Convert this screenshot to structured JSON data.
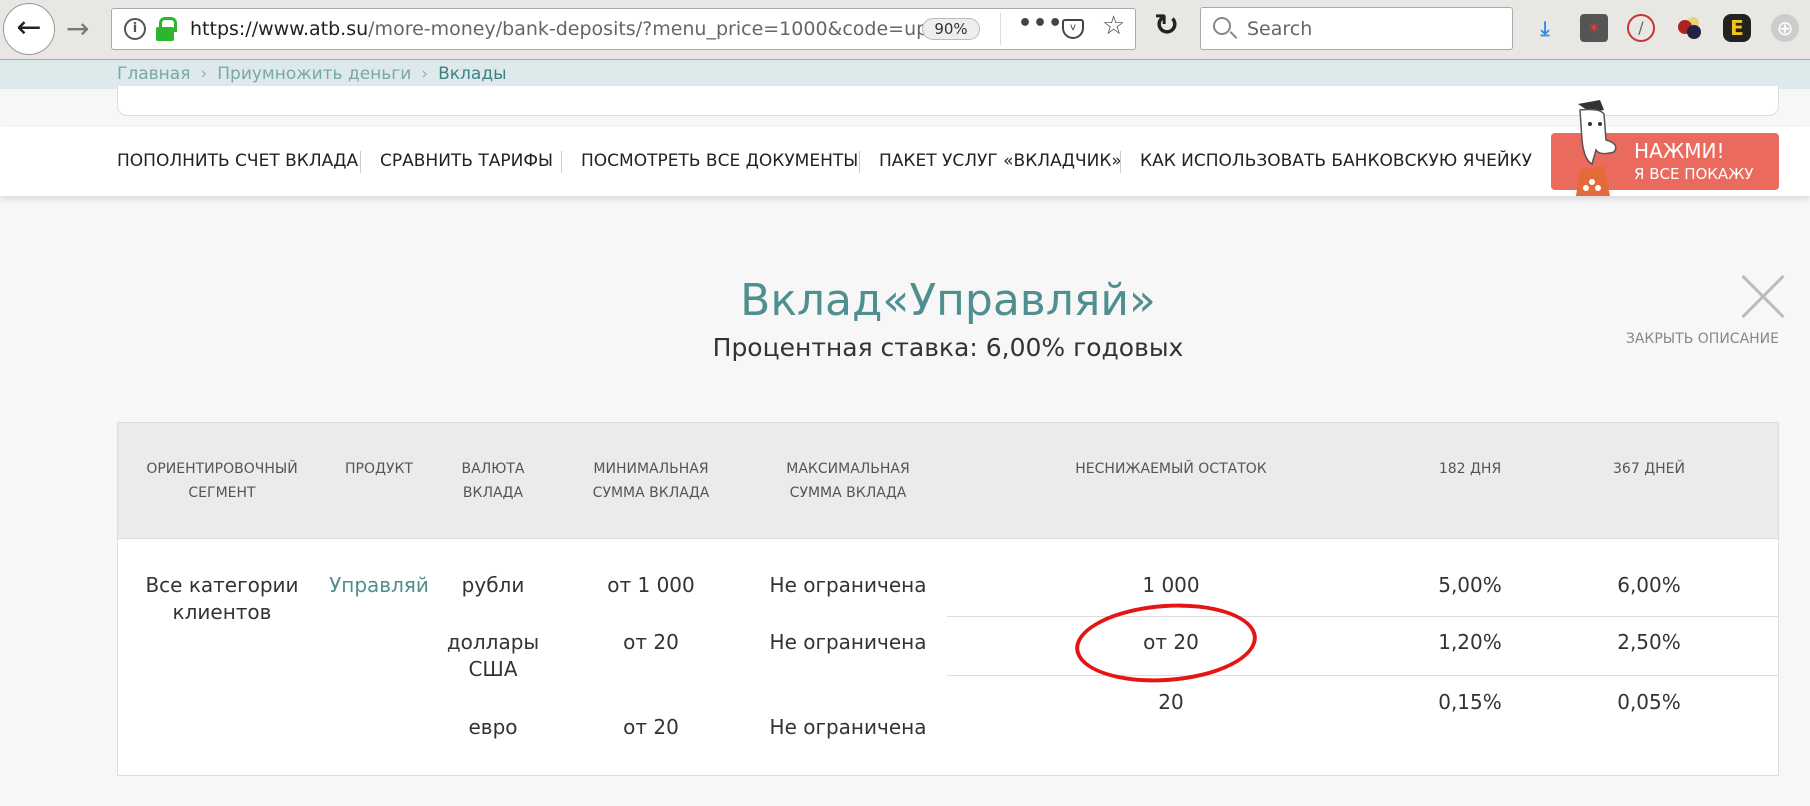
{
  "browser": {
    "url_host": "https://www.atb.su",
    "url_path": "/more-money/bank-deposits/?menu_price=1000&code=up",
    "zoom": "90%",
    "search_placeholder": "Search"
  },
  "breadcrumb": [
    {
      "label": "Главная"
    },
    {
      "label": "Приумножить деньги"
    },
    {
      "label": "Вклады"
    }
  ],
  "nav": {
    "items": [
      "ПОПОЛНИТЬ СЧЕТ ВКЛАДА",
      "СРАВНИТЬ ТАРИФЫ",
      "ПОСМОТРЕТЬ ВСЕ ДОКУМЕНТЫ",
      "ПАКЕТ УСЛУГ «ВКЛАДЧИК»",
      "КАК ИСПОЛЬЗОВАТЬ БАНКОВСКУЮ ЯЧЕЙКУ"
    ],
    "cta_line1": "НАЖМИ!",
    "cta_line2": "Я ВСЕ ПОКАЖУ",
    "cta_color": "#ea6a5d"
  },
  "deposit": {
    "title": "Вклад«Управляй»",
    "rate": "Процентная ставка: 6,00% годовых",
    "close_label": "ЗАКРЫТЬ ОПИСАНИЕ",
    "accent": "#4f8f8f"
  },
  "table": {
    "headers": [
      [
        "ОРИЕНТИРОВОЧНЫЙ",
        "СЕГМЕНТ"
      ],
      [
        "ПРОДУКТ",
        ""
      ],
      [
        "ВАЛЮТА",
        "ВКЛАДА"
      ],
      [
        "МИНИМАЛЬНАЯ",
        "СУММА ВКЛАДА"
      ],
      [
        "МАКСИМАЛЬНАЯ",
        "СУММА ВКЛАДА"
      ],
      [
        "НЕСНИЖАЕМЫЙ ОСТАТОК",
        ""
      ],
      [
        "182 ДНЯ",
        ""
      ],
      [
        "367 ДНЕЙ",
        ""
      ]
    ],
    "segment": [
      "Все категории",
      "клиентов"
    ],
    "product": "Управляй",
    "rows": [
      {
        "currency": [
          "рубли",
          ""
        ],
        "min": "от 1 000",
        "max": "Не ограничена",
        "balance": "1 000",
        "d182": "5,00%",
        "d367": "6,00%"
      },
      {
        "currency": [
          "доллары",
          "США"
        ],
        "min": "от 20",
        "max": "Не ограничена",
        "balance": "от 20",
        "d182": "1,20%",
        "d367": "2,50%"
      },
      {
        "currency": [
          "евро",
          ""
        ],
        "min": "от 20",
        "max": "Не ограничена",
        "balance": "20",
        "d182": "0,15%",
        "d367": "0,05%"
      }
    ],
    "annotation_color": "#e51515"
  }
}
